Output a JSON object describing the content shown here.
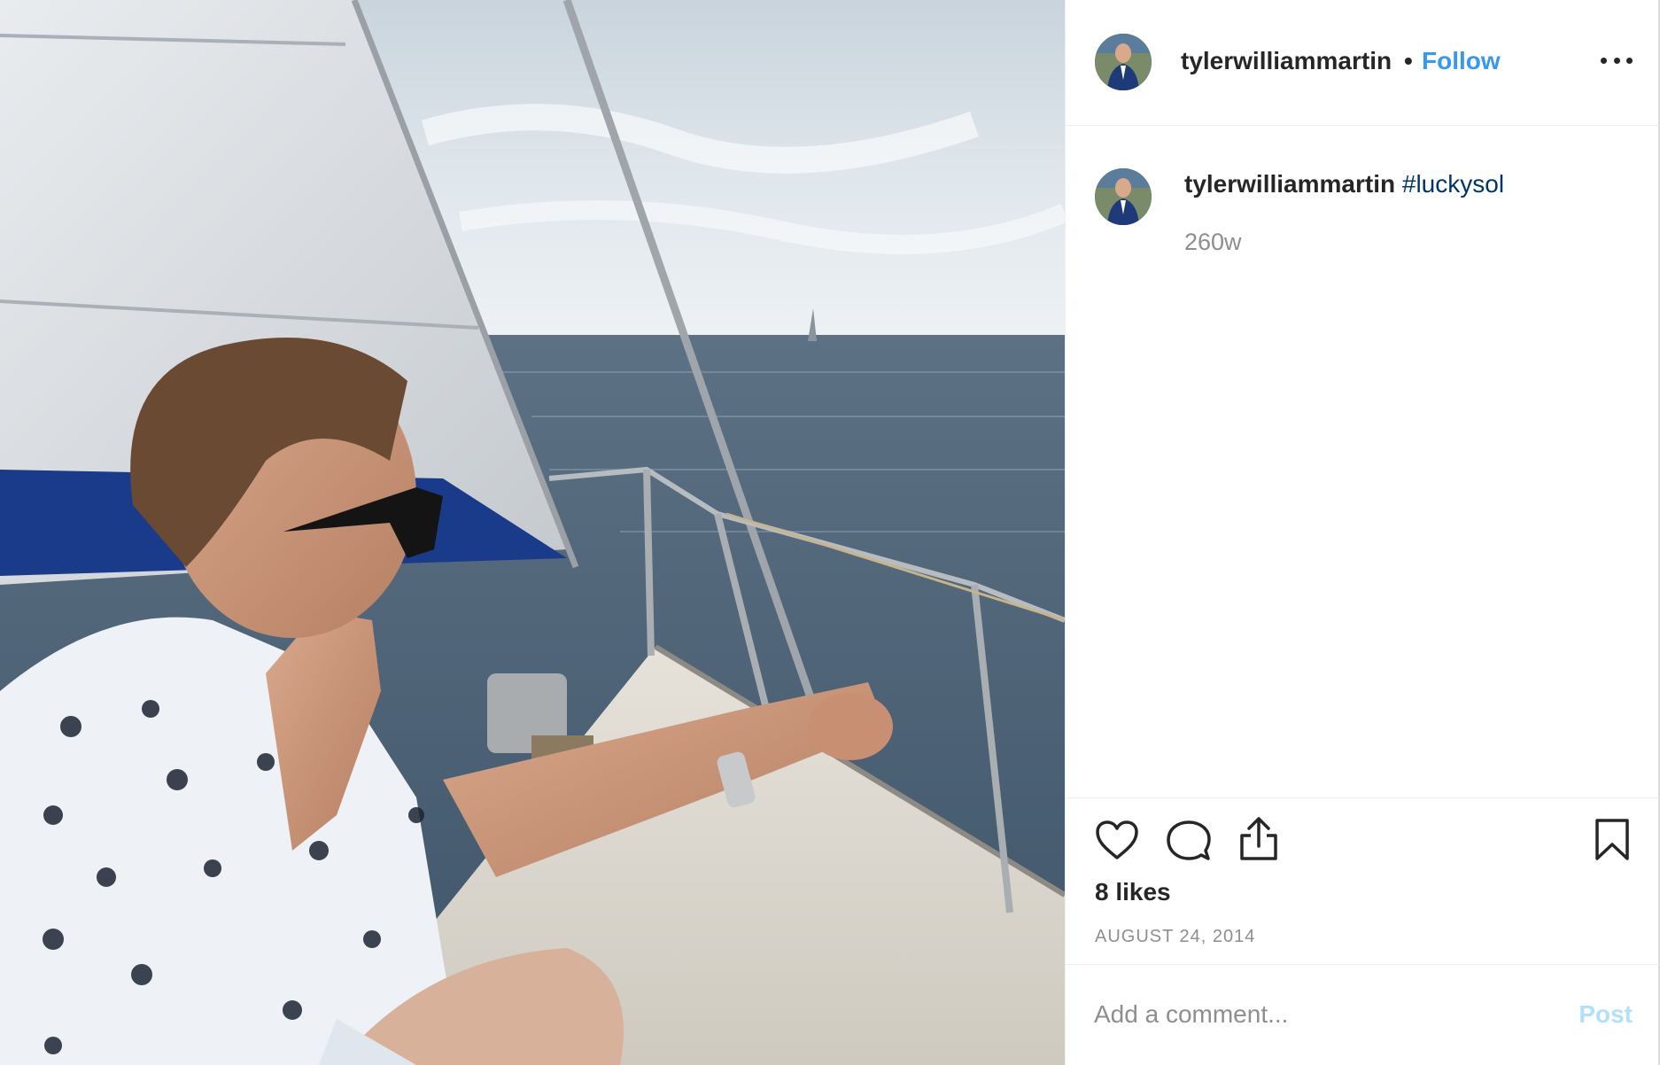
{
  "header": {
    "username": "tylerwilliammartin",
    "separator": "•",
    "follow_label": "Follow"
  },
  "caption": {
    "username": "tylerwilliammartin",
    "hashtag": "#luckysol",
    "time_ago": "260w"
  },
  "stats": {
    "likes": "8 likes",
    "date": "AUGUST 24, 2014"
  },
  "comment": {
    "placeholder": "Add a comment...",
    "post_label": "Post"
  },
  "icons": {
    "like": "heart-icon",
    "comment": "comment-icon",
    "share": "share-icon",
    "save": "bookmark-icon",
    "more": "more-options-icon"
  },
  "colors": {
    "follow": "#3897f0",
    "hashtag": "#003569",
    "secondary_text": "#8e8e8e",
    "post_disabled": "#b2dffc"
  }
}
